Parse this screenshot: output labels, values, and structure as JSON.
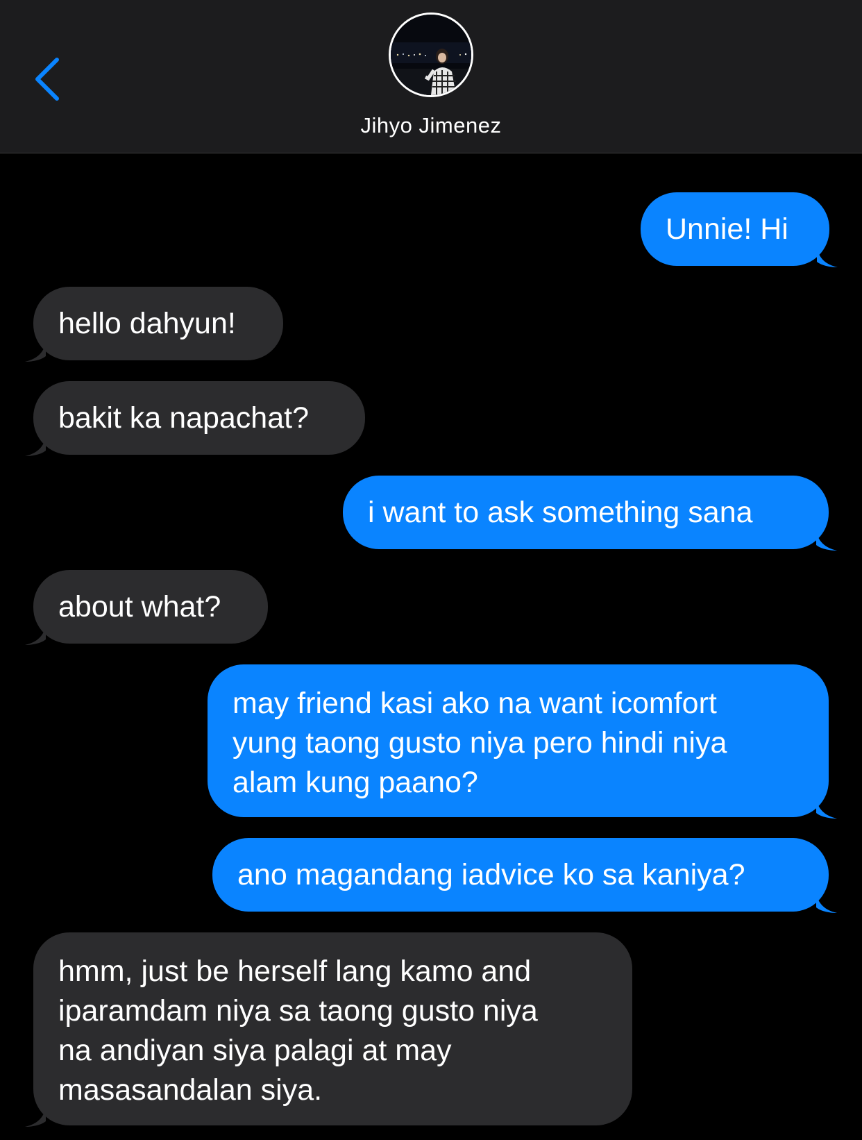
{
  "header": {
    "contact_name": "Jihyo Jimenez"
  },
  "colors": {
    "sent_bubble": "#0a84ff",
    "received_bubble": "#2c2c2e",
    "header_bg": "#1c1c1e",
    "back_chevron": "#0a84ff"
  },
  "icons": {
    "back": "chevron-left-icon",
    "avatar": "contact-photo"
  },
  "messages": [
    {
      "direction": "sent",
      "text": "Unnie! Hi"
    },
    {
      "direction": "received",
      "text": "hello dahyun!"
    },
    {
      "direction": "received",
      "text": "bakit ka napachat?"
    },
    {
      "direction": "sent",
      "text": "i want to ask something sana"
    },
    {
      "direction": "received",
      "text": "about what?"
    },
    {
      "direction": "sent",
      "text": "may friend kasi ako na want icomfort\nyung taong gusto niya pero hindi niya\nalam kung paano?"
    },
    {
      "direction": "sent",
      "text": "ano magandang iadvice ko sa kaniya?"
    },
    {
      "direction": "received",
      "text": "hmm, just be herself lang kamo and\niparamdam niya sa taong gusto niya\nna andiyan siya palagi at may\nmasasandalan siya."
    }
  ]
}
